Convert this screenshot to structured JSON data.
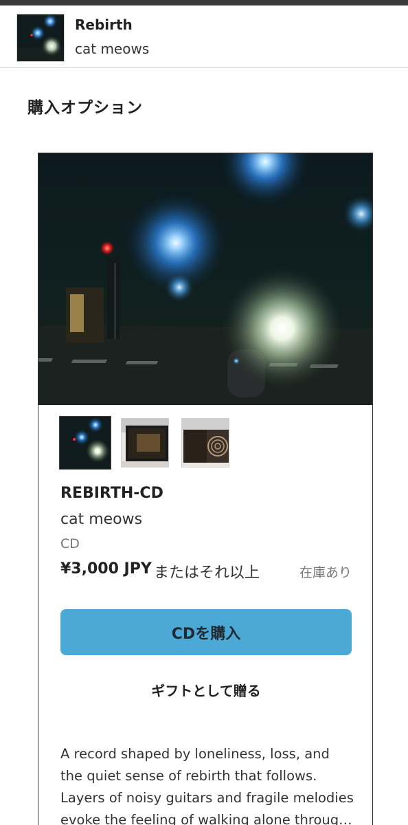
{
  "header": {
    "title": "Rebirth",
    "artist": "cat meows"
  },
  "section_heading": "購入オプション",
  "package": {
    "title": "REBIRTH-CD",
    "artist": "cat meows",
    "format": "CD",
    "price": "¥3,000 JPY",
    "price_suffix": "またはそれ以上",
    "stock_status": "在庫あり",
    "buy_label": "CDを購入",
    "gift_label": "ギフトとして贈る",
    "description": [
      "A record shaped by loneliness, loss, and",
      "the quiet sense of rebirth that follows.",
      "Layers of noisy guitars and fragile melodies",
      "evoke the feeling of walking alone throug…"
    ]
  },
  "colors": {
    "accent": "#4ca8d4",
    "topbar": "#3a3a3c"
  }
}
